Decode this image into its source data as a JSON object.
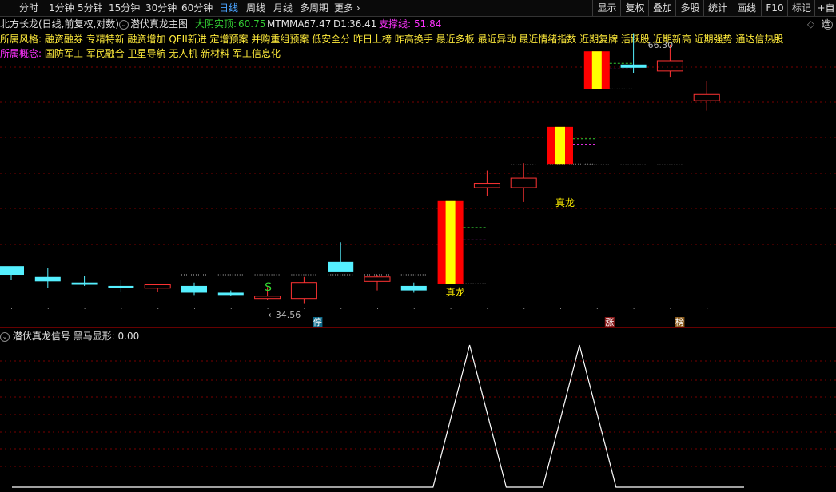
{
  "toolbar": {
    "periods": [
      "分时",
      "1分钟",
      "5分钟",
      "15分钟",
      "30分钟",
      "60分钟",
      "日线",
      "周线",
      "月线",
      "多周期",
      "更多"
    ],
    "active_period": "日线",
    "right_buttons": [
      "显示",
      "复权",
      "叠加",
      "多股",
      "统计",
      "画线",
      "F10",
      "标记",
      "+自选"
    ]
  },
  "header": {
    "stock": "北方长龙(日线,前复权,对数)",
    "indicator": "潜伏真龙主图",
    "dayin_label": "大阴实顶:",
    "dayin_value": "60.75",
    "mtmma_label": "MTMMA:",
    "mtmma_value": "67.47",
    "d1_label": "D1:",
    "d1_value": "36.41",
    "support_label": "支撑线:",
    "support_value": "51.84"
  },
  "style_row": {
    "label": "所属风格:",
    "text": "融资融券 专精特新 融资增加 QFII新进 定增预案 并购重组预案 低安全分 昨日上榜 昨高换手 最近多板 最近异动 最近情绪指数 近期复牌 活跃股 近期新高 近期强势 通达信热股"
  },
  "concept_row": {
    "label": "所属概念:",
    "text": "国防军工 军民融合 卫星导航 无人机 新材料 军工信息化"
  },
  "chart_labels": {
    "s_marker": "S",
    "low_price": "←34.56",
    "high_price": "66.30",
    "zhenlong_1": "真龙",
    "zhenlong_2": "真龙",
    "ting": "停",
    "zhang": "涨",
    "bang": "榜"
  },
  "lower_panel": {
    "title": "潜伏真龙信号",
    "metric_label": "黑马显形:",
    "metric_value": "0.00"
  },
  "candles": [
    {
      "o": 35.8,
      "h": 36.5,
      "l": 35.3,
      "c": 36.6,
      "color": "cyan"
    },
    {
      "o": 35.6,
      "h": 36.4,
      "l": 34.6,
      "c": 35.2,
      "color": "cyan"
    },
    {
      "o": 35.1,
      "h": 35.7,
      "l": 34.8,
      "c": 34.9,
      "color": "cyan"
    },
    {
      "o": 34.8,
      "h": 35.3,
      "l": 34.3,
      "c": 34.6,
      "color": "cyan"
    },
    {
      "o": 34.6,
      "h": 35.0,
      "l": 34.3,
      "c": 34.9,
      "color": "red_hollow"
    },
    {
      "o": 34.8,
      "h": 35.1,
      "l": 34.0,
      "c": 34.2,
      "color": "cyan"
    },
    {
      "o": 34.2,
      "h": 34.4,
      "l": 33.9,
      "c": 34.0,
      "color": "cyan"
    },
    {
      "o": 33.7,
      "h": 34.7,
      "l": 33.6,
      "c": 33.9,
      "color": "red_hollow"
    },
    {
      "o": 33.7,
      "h": 35.6,
      "l": 33.3,
      "c": 35.1,
      "color": "red_hollow"
    },
    {
      "o": 37.0,
      "h": 38.9,
      "l": 36.2,
      "c": 36.1,
      "color": "cyan"
    },
    {
      "o": 35.2,
      "h": 35.8,
      "l": 34.4,
      "c": 35.6,
      "color": "red_hollow"
    },
    {
      "o": 34.8,
      "h": 35.1,
      "l": 34.2,
      "c": 34.4,
      "color": "cyan"
    },
    {
      "o": 35.0,
      "h": 43.2,
      "l": 35.0,
      "c": 43.2,
      "color": "zhenlong"
    },
    {
      "o": 44.7,
      "h": 46.7,
      "l": 43.8,
      "c": 45.2,
      "color": "red_hollow"
    },
    {
      "o": 44.7,
      "h": 47.6,
      "l": 43.1,
      "c": 45.8,
      "color": "red_hollow"
    },
    {
      "o": 47.5,
      "h": 52.2,
      "l": 47.5,
      "c": 52.2,
      "color": "zhenlong"
    },
    {
      "o": 57.5,
      "h": 63.3,
      "l": 57.5,
      "c": 63.3,
      "color": "zhenlong"
    },
    {
      "o": 61.2,
      "h": 66.3,
      "l": 59.9,
      "c": 60.7,
      "color": "cyan"
    },
    {
      "o": 60.2,
      "h": 64.4,
      "l": 59.2,
      "c": 61.8,
      "color": "red_hollow"
    },
    {
      "o": 55.8,
      "h": 58.7,
      "l": 54.4,
      "c": 56.7,
      "color": "red_hollow"
    }
  ],
  "signal": [
    0,
    0,
    0,
    0,
    0,
    0,
    0,
    0,
    0,
    0,
    0,
    0,
    1,
    0,
    0,
    1,
    0,
    0,
    0,
    0
  ],
  "colors": {
    "up_red": "#ff3333",
    "down_cyan": "#55f0ff",
    "zhenlong_red": "#ff0000",
    "zhenlong_yellow": "#ffff00",
    "grid": "#7a0000",
    "magenta": "#ff33ff",
    "green": "#33cc33"
  }
}
